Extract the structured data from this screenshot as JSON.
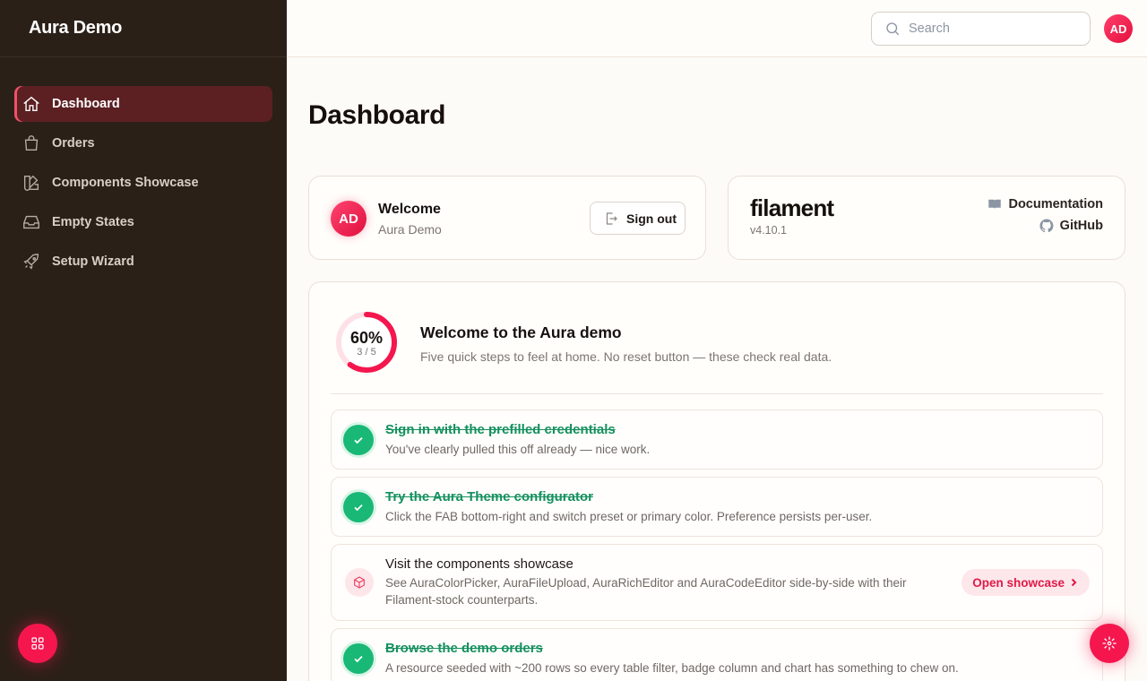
{
  "app": {
    "brand": "Aura Demo"
  },
  "sidebar": {
    "items": [
      {
        "label": "Dashboard",
        "icon": "home-icon",
        "active": true
      },
      {
        "label": "Orders",
        "icon": "shopping-bag-icon"
      },
      {
        "label": "Components Showcase",
        "icon": "swatch-icon"
      },
      {
        "label": "Empty States",
        "icon": "inbox-icon"
      },
      {
        "label": "Setup Wizard",
        "icon": "rocket-icon"
      }
    ]
  },
  "topbar": {
    "search_placeholder": "Search",
    "avatar_initials": "AD"
  },
  "page": {
    "title": "Dashboard"
  },
  "welcome": {
    "initials": "AD",
    "title": "Welcome",
    "name": "Aura Demo",
    "signout_label": "Sign out"
  },
  "filament": {
    "logo": "filament",
    "version": "v4.10.1",
    "documentation_label": "Documentation",
    "github_label": "GitHub"
  },
  "onboarding": {
    "percent_label": "60%",
    "fraction_label": "3 / 5",
    "progress": 0.6,
    "title": "Welcome to the Aura demo",
    "subtitle": "Five quick steps to feel at home. No reset button — these check real data.",
    "steps": [
      {
        "title": "Sign in with the prefilled credentials",
        "description": "You've clearly pulled this off already — nice work.",
        "done": true
      },
      {
        "title": "Try the Aura Theme configurator",
        "description": "Click the FAB bottom-right and switch preset or primary color. Preference persists per-user.",
        "done": true
      },
      {
        "title": "Visit the components showcase",
        "description_line1": "See AuraColorPicker, AuraFileUpload, AuraRichEditor and AuraCodeEditor side-by-side with their",
        "description_line2": "Filament-stock counterparts.",
        "done": false,
        "action_label": "Open showcase"
      },
      {
        "title": "Browse the demo orders",
        "description": "A resource seeded with ~200 rows so every table filter, badge column and chart has something to chew on.",
        "done": true
      }
    ]
  },
  "colors": {
    "accent": "#f5164e",
    "sidebar_bg": "#2b2018",
    "success": "#19b877"
  }
}
